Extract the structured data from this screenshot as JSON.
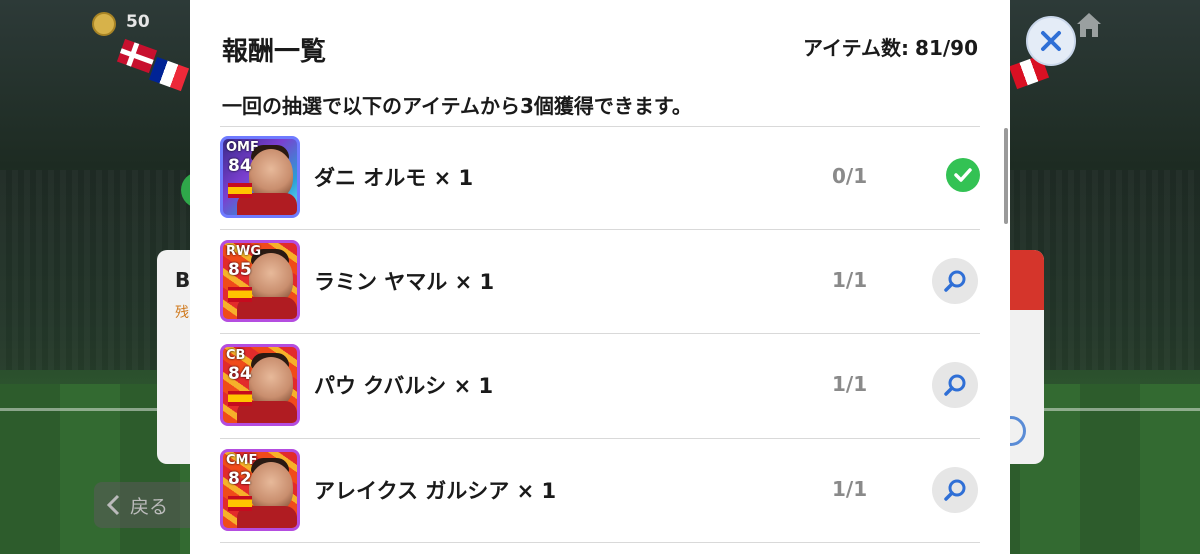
{
  "background": {
    "coin_count": "50",
    "back_label": "戻る",
    "left_card_letter": "B",
    "left_card_text": "残"
  },
  "modal": {
    "title": "報酬一覧",
    "item_count_label": "アイテム数:",
    "item_count_value": "81/90",
    "description": "一回の抽選で以下のアイテムから3個獲得できます。",
    "items": [
      {
        "position": "OMF",
        "rating": "84",
        "name": "ダニ オルモ × 1",
        "quantity": "0/1",
        "status": "obtained"
      },
      {
        "position": "RWG",
        "rating": "85",
        "name": "ラミン ヤマル × 1",
        "quantity": "1/1",
        "status": "available"
      },
      {
        "position": "CB",
        "rating": "84",
        "name": "パウ クバルシ × 1",
        "quantity": "1/1",
        "status": "available"
      },
      {
        "position": "CMF",
        "rating": "82",
        "name": "アレイクス ガルシア × 1",
        "quantity": "1/1",
        "status": "available"
      }
    ]
  },
  "colors": {
    "check_green": "#33c254",
    "search_blue": "#2f6fd6",
    "close_blue": "#2f6fd6"
  },
  "icons": [
    "coin-icon",
    "home-icon",
    "close-icon",
    "check-icon",
    "search-icon",
    "chevron-left-icon",
    "spain-flag-icon"
  ]
}
